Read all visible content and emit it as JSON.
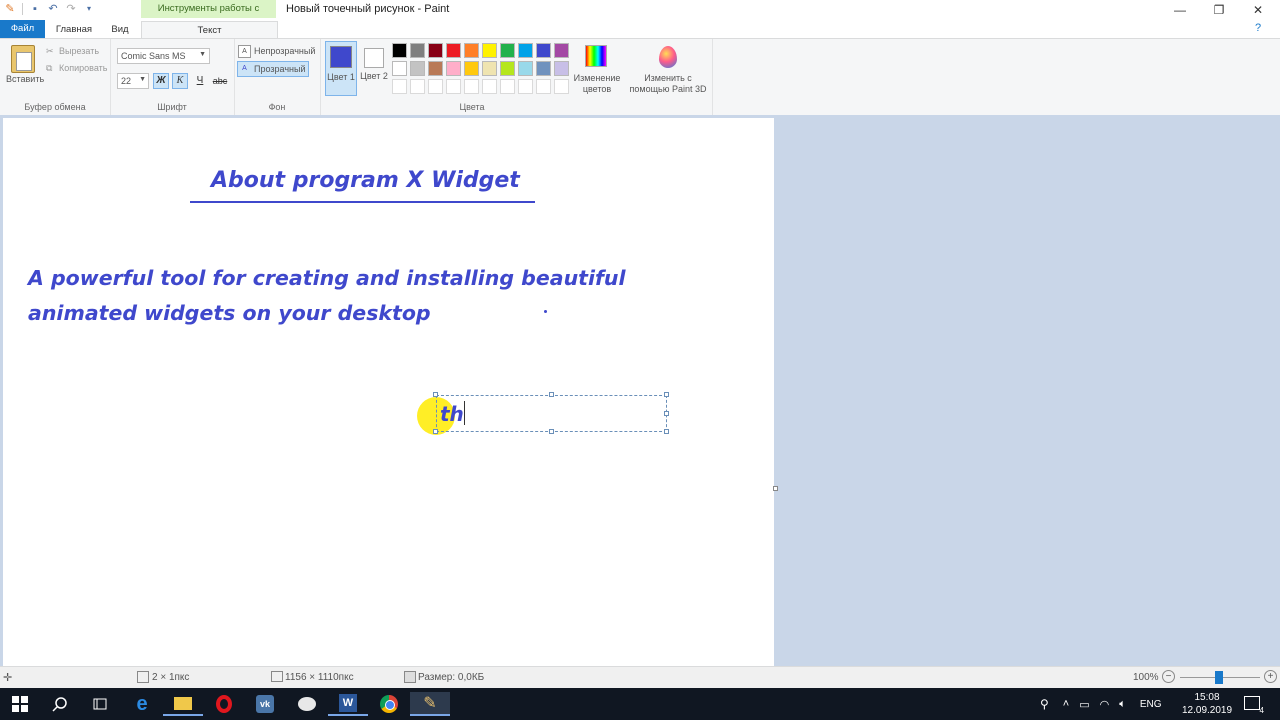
{
  "titlebar": {
    "context_tab": "Инструменты работы с текстом",
    "title": "Новый точечный рисунок - Paint",
    "minimize": "—",
    "restore": "❐",
    "close": "✕"
  },
  "tabs": {
    "file": "Файл",
    "home": "Главная",
    "view": "Вид",
    "text": "Текст"
  },
  "clipboard": {
    "paste": "Вставить",
    "cut": "Вырезать",
    "copy": "Копировать",
    "label": "Буфер обмена"
  },
  "font": {
    "family": "Comic Sans MS",
    "size": "22",
    "bold": "Ж",
    "italic": "К",
    "underline": "Ч",
    "strike": "abc",
    "label": "Шрифт"
  },
  "background": {
    "opaque": "Непрозрачный",
    "transparent": "Прозрачный",
    "label": "Фон"
  },
  "colors": {
    "color1_label": "Цвет 1",
    "color2_label": "Цвет 2",
    "color1": "#3f48cc",
    "color2": "#ffffff",
    "edit_colors": "Изменение цветов",
    "paint3d": "Изменить с помощью Paint 3D",
    "label": "Цвета",
    "palette_row1": [
      "#000000",
      "#7f7f7f",
      "#880015",
      "#ed1c24",
      "#ff7f27",
      "#fff200",
      "#22b14c",
      "#00a2e8",
      "#3f48cc",
      "#a349a4"
    ],
    "palette_row2": [
      "#ffffff",
      "#c3c3c3",
      "#b97a57",
      "#ffaec9",
      "#ffc90e",
      "#efe4b0",
      "#b5e61d",
      "#99d9ea",
      "#7092be",
      "#c8bfe7"
    ]
  },
  "canvas": {
    "heading": "About program X Widget",
    "line1": "A powerful tool for creating and installing beautiful",
    "line2": "animated widgets on your desktop",
    "typing": "th"
  },
  "status": {
    "selection": "2 × 1пкс",
    "image_size": "1156 × 1110пкс",
    "file_size": "Размер: 0,0КБ",
    "zoom": "100%"
  },
  "taskbar": {
    "lang": "ENG",
    "time": "15:08",
    "date": "12.09.2019",
    "notifications": "4"
  }
}
